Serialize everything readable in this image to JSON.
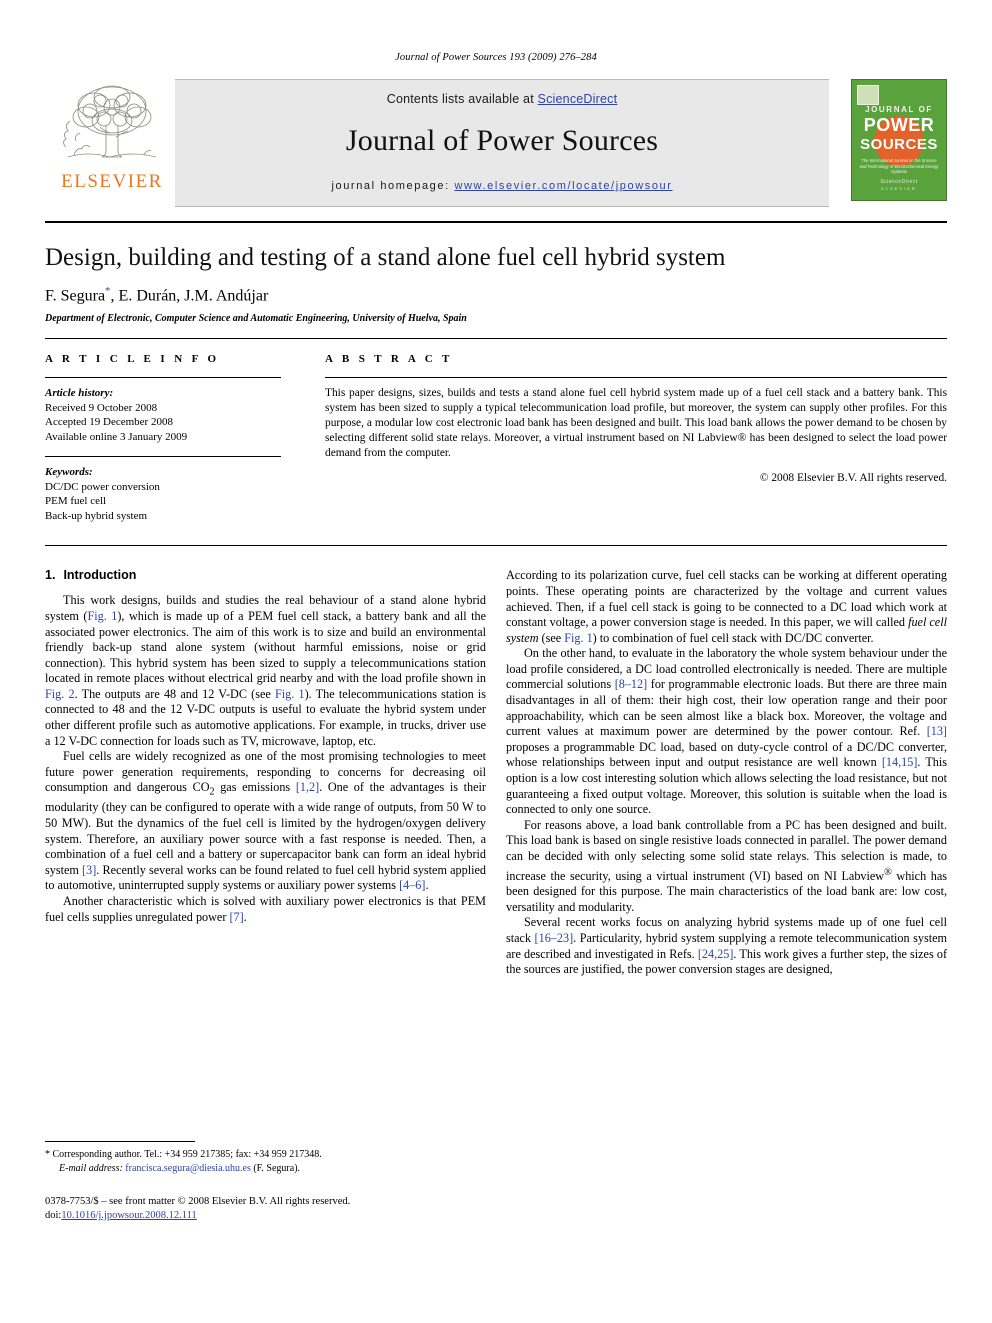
{
  "running_head": "Journal of Power Sources 193 (2009) 276–284",
  "masthead": {
    "contents_prefix": "Contents lists available at ",
    "sciencedirect": "ScienceDirect",
    "journal_title": "Journal of Power Sources",
    "homepage_label": "journal homepage: ",
    "homepage_url": "www.elsevier.com/locate/jpowsour",
    "publisher_name": "ELSEVIER",
    "accent_orange": "#e87722",
    "link_blue": "#2d43a8",
    "cover": {
      "line1": "JOURNAL OF",
      "line2": "POWER",
      "line3": "SOURCES",
      "subtitle": "The International Journal on the Science and Technology of Electrochemical Energy Systems",
      "footer": "ScienceDirect",
      "footer_sub": "ELSEVIER",
      "bg_color": "#5aa23c",
      "circle_color": "#e2622a"
    }
  },
  "article": {
    "title": "Design, building and testing of a stand alone fuel cell hybrid system",
    "authors": "F. Segura",
    "authors_star": "*",
    "authors_rest": ", E. Durán, J.M. Andújar",
    "affiliation": "Department of Electronic, Computer Science and Automatic Engineering, University of Huelva, Spain"
  },
  "article_info": {
    "label": "A R T I C L E    I N F O",
    "history_head": "Article history:",
    "history": [
      "Received 9 October 2008",
      "Accepted 19 December 2008",
      "Available online 3 January 2009"
    ],
    "keywords_head": "Keywords:",
    "keywords": [
      "DC/DC power conversion",
      "PEM fuel cell",
      "Back-up hybrid system"
    ]
  },
  "abstract": {
    "label": "A B S T R A C T",
    "text": "This paper designs, sizes, builds and tests a stand alone fuel cell hybrid system made up of a fuel cell stack and a battery bank. This system has been sized to supply a typical telecommunication load profile, but moreover, the system can supply other profiles. For this purpose, a modular low cost electronic load bank has been designed and built. This load bank allows the power demand to be chosen by selecting different solid state relays. Moreover, a virtual instrument based on NI Labview® has been designed to select the load power demand from the computer.",
    "copyright": "© 2008 Elsevier B.V. All rights reserved."
  },
  "body": {
    "section_number": "1.",
    "section_title": "Introduction",
    "left_paragraphs": [
      "This work designs, builds and studies the real behaviour of a stand alone hybrid system (Fig. 1), which is made up of a PEM fuel cell stack, a battery bank and all the associated power electronics. The aim of this work is to size and build an environmental friendly back-up stand alone system (without harmful emissions, noise or grid connection). This hybrid system has been sized to supply a telecommunications station located in remote places without electrical grid nearby and with the load profile shown in Fig. 2. The outputs are 48 and 12 V-DC (see Fig. 1). The telecommunications station is connected to 48 and the 12 V-DC outputs is useful to evaluate the hybrid system under other different profile such as automotive applications. For example, in trucks, driver use a 12 V-DC connection for loads such as TV, microwave, laptop, etc.",
      "Fuel cells are widely recognized as one of the most promising technologies to meet future power generation requirements, responding to concerns for decreasing oil consumption and dangerous CO2 gas emissions [1,2]. One of the advantages is their modularity (they can be configured to operate with a wide range of outputs, from 50 W to 50 MW). But the dynamics of the fuel cell is limited by the hydrogen/oxygen delivery system. Therefore, an auxiliary power source with a fast response is needed. Then, a combination of a fuel cell and a battery or supercapacitor bank can form an ideal hybrid system [3]. Recently several works can be found related to fuel cell hybrid system applied to automotive, uninterrupted supply systems or auxiliary power systems [4–6].",
      "Another characteristic which is solved with auxiliary power electronics is that PEM fuel cells supplies unregulated power [7]."
    ],
    "right_paragraphs": [
      "According to its polarization curve, fuel cell stacks can be working at different operating points. These operating points are characterized by the voltage and current values achieved. Then, if a fuel cell stack is going to be connected to a DC load which work at constant voltage, a power conversion stage is needed. In this paper, we will called fuel cell system (see Fig. 1) to combination of fuel cell stack with DC/DC converter.",
      "On the other hand, to evaluate in the laboratory the whole system behaviour under the load profile considered, a DC load controlled electronically is needed. There are multiple commercial solutions [8–12] for programmable electronic loads. But there are three main disadvantages in all of them: their high cost, their low operation range and their poor approachability, which can be seen almost like a black box. Moreover, the voltage and current values at maximum power are determined by the power contour. Ref. [13] proposes a programmable DC load, based on duty-cycle control of a DC/DC converter, whose relationships between input and output resistance are well known [14,15]. This option is a low cost interesting solution which allows selecting the load resistance, but not guaranteeing a fixed output voltage. Moreover, this solution is suitable when the load is connected to only one source.",
      "For reasons above, a load bank controllable from a PC has been designed and built. This load bank is based on single resistive loads connected in parallel. The power demand can be decided with only selecting some solid state relays. This selection is made, to increase the security, using a virtual instrument (VI) based on NI Labview® which has been designed for this purpose. The main characteristics of the load bank are: low cost, versatility and modularity.",
      "Several recent works focus on analyzing hybrid systems made up of one fuel cell stack [16–23]. Particularity, hybrid system supplying a remote telecommunication system are described and investigated in Refs. [24,25]. This work gives a further step, the sizes of the sources are justified, the power conversion stages are designed,"
    ]
  },
  "footnote": {
    "star": "*",
    "corresponding": "Corresponding author. Tel.: +34 959 217385; fax: +34 959 217348.",
    "email_label": "E-mail address:",
    "email": "francisca.segura@diesia.uhu.es",
    "email_suffix": "(F. Segura)."
  },
  "imprint": {
    "line1": "0378-7753/$ – see front matter © 2008 Elsevier B.V. All rights reserved.",
    "doi_label": "doi:",
    "doi_value": "10.1016/j.jpowsour.2008.12.111"
  }
}
